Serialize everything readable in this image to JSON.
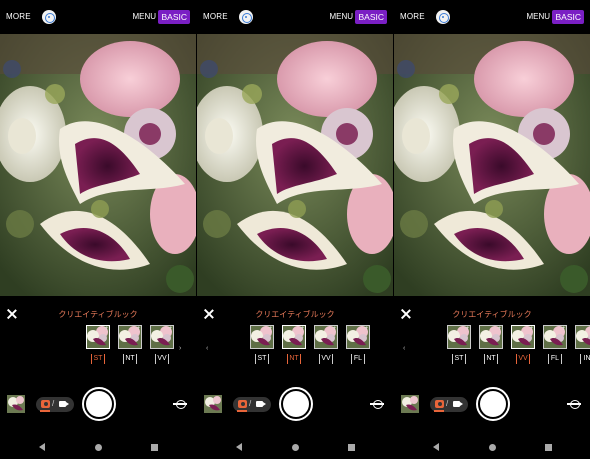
{
  "topbar": {
    "more_label": "MORE",
    "menu_label": "MENU",
    "mode_label": "BASIC"
  },
  "panel": {
    "title": "クリエイティブルック"
  },
  "screens": [
    {
      "looks": [
        {
          "code": "ST",
          "selected": true
        },
        {
          "code": "NT",
          "selected": false
        },
        {
          "code": "VV",
          "selected": false
        }
      ],
      "left_chevron": false
    },
    {
      "looks": [
        {
          "code": "ST",
          "selected": false
        },
        {
          "code": "NT",
          "selected": true
        },
        {
          "code": "VV",
          "selected": false
        },
        {
          "code": "FL",
          "selected": false
        }
      ],
      "left_chevron": true
    },
    {
      "looks": [
        {
          "code": "ST",
          "selected": false
        },
        {
          "code": "NT",
          "selected": false
        },
        {
          "code": "VV",
          "selected": true
        },
        {
          "code": "FL",
          "selected": false
        },
        {
          "code": "IN",
          "selected": false
        }
      ],
      "left_chevron": true
    }
  ],
  "icons": {
    "lens": "google-lens-icon",
    "close": "close-icon",
    "chevron_left": "‹",
    "chevron_right": "›",
    "thumb_plus": "+",
    "mode_separator": "/",
    "switch_camera": "switch-camera-icon"
  },
  "colors": {
    "accent": "#e8653a",
    "basic_badge": "#7a1fc4",
    "panel_title": "#e87a5a"
  }
}
